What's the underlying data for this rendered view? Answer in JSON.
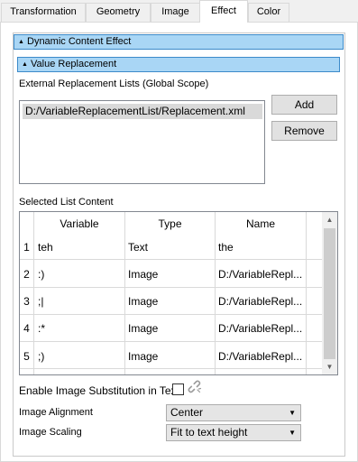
{
  "tabs": [
    "Transformation",
    "Geometry",
    "Image",
    "Effect",
    "Color"
  ],
  "active_tab": "Effect",
  "groups": {
    "dynamic": "Dynamic Content Effect",
    "value": "Value Replacement"
  },
  "external_lists": {
    "label": "External Replacement Lists (Global Scope)",
    "items": [
      "D:/VariableReplacementList/Replacement.xml"
    ],
    "add_label": "Add",
    "remove_label": "Remove"
  },
  "selected_list": {
    "label": "Selected List Content",
    "columns": [
      "Variable",
      "Type",
      "Name"
    ],
    "rows": [
      {
        "num": "1",
        "variable": "teh",
        "type": "Text",
        "name": "the"
      },
      {
        "num": "2",
        "variable": ":)",
        "type": "Image",
        "name": "D:/VariableRepl..."
      },
      {
        "num": "3",
        "variable": ";|",
        "type": "Image",
        "name": "D:/VariableRepl..."
      },
      {
        "num": "4",
        "variable": ":*",
        "type": "Image",
        "name": "D:/VariableRepl..."
      },
      {
        "num": "5",
        "variable": ";)",
        "type": "Image",
        "name": "D:/VariableRepl..."
      }
    ]
  },
  "options": {
    "enable_label": "Enable Image Substitution in Text",
    "enable_checked": false,
    "alignment_label": "Image Alignment",
    "alignment_value": "Center",
    "scaling_label": "Image Scaling",
    "scaling_value": "Fit to text height"
  },
  "icons": {
    "collapse": "collapse-triangle-icon",
    "link": "chain-link-icon",
    "dropdown": "dropdown-caret-icon"
  },
  "colors": {
    "group_header_bg": "#a9d6f5",
    "group_header_border": "#3c8ac9",
    "selection_bg": "#d9d9d9"
  }
}
